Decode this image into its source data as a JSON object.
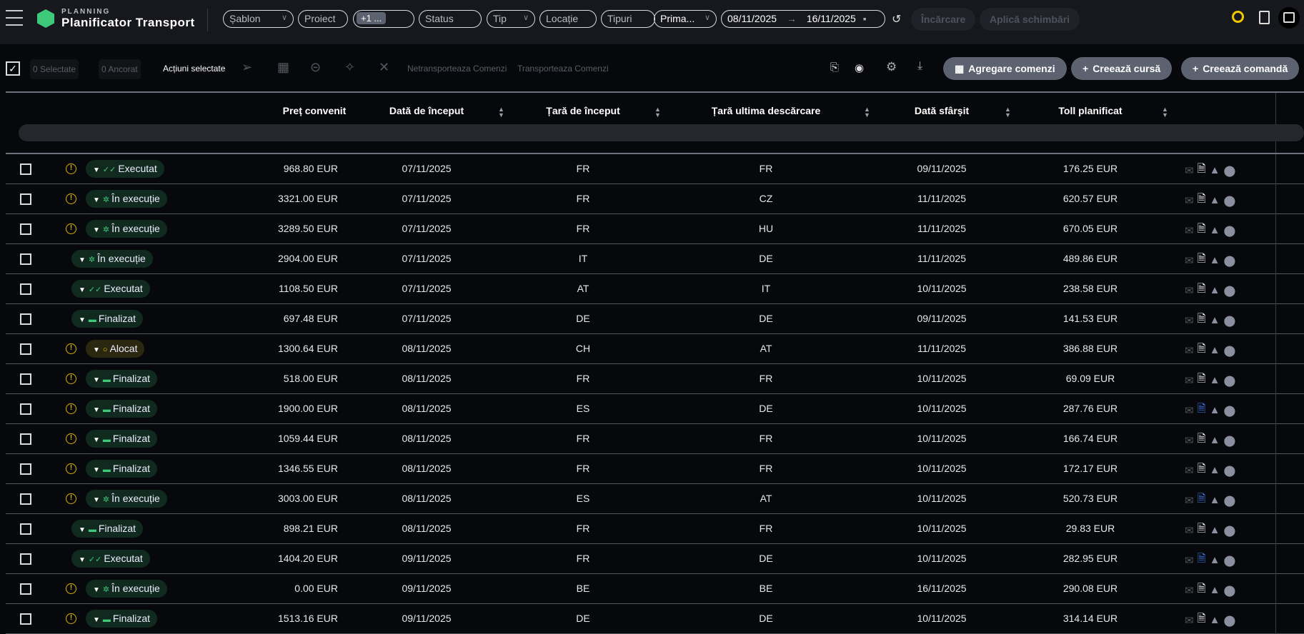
{
  "header": {
    "brand_small": "PLANNING",
    "brand": "Planificator Transport",
    "filters": {
      "sablon": "Șablon",
      "proiect": "Proiect",
      "chip": "+1 ...",
      "status": "Status",
      "tip": "Tip",
      "locatie": "Locație",
      "tipuri": "Tipuri",
      "prima": "Prima...",
      "date_from": "08/11/2025",
      "date_to": "16/11/2025"
    },
    "incarcare": "Încărcare",
    "aplica": "Aplică schimbări"
  },
  "toolbar": {
    "selectate": "0 Selectate",
    "ancorat": "0 Ancorat",
    "actiuni": "Acțiuni selectate",
    "netransporteaza": "Netransporteaza Comenzi",
    "transporteaza": "Transporteaza Comenzi",
    "agregare": "Agregare comenzi",
    "creeaza_cursa": "Creează cursă",
    "creeaza_comanda": "Creează comandă"
  },
  "columns": {
    "pret": "Preț convenit",
    "data_inceput": "Dată de început",
    "tara_inceput": "Țară de început",
    "tara_ultima": "Țară ultima descărcare",
    "data_sfarsit": "Dată sfârșit",
    "toll": "Toll planificat"
  },
  "rows": [
    {
      "warn": true,
      "status": "Executat",
      "type": "exec",
      "price": "968.80 EUR",
      "start": "07/11/2025",
      "from": "FR",
      "to": "FR",
      "end": "09/11/2025",
      "toll": "176.25 EUR",
      "doc_blue": false
    },
    {
      "warn": true,
      "status": "În execuție",
      "type": "prog",
      "price": "3321.00 EUR",
      "start": "07/11/2025",
      "from": "FR",
      "to": "CZ",
      "end": "11/11/2025",
      "toll": "620.57 EUR",
      "doc_blue": false
    },
    {
      "warn": true,
      "status": "În execuție",
      "type": "prog",
      "price": "3289.50 EUR",
      "start": "07/11/2025",
      "from": "FR",
      "to": "HU",
      "end": "11/11/2025",
      "toll": "670.05 EUR",
      "doc_blue": false
    },
    {
      "warn": false,
      "status": "În execuție",
      "type": "prog",
      "price": "2904.00 EUR",
      "start": "07/11/2025",
      "from": "IT",
      "to": "DE",
      "end": "11/11/2025",
      "toll": "489.86 EUR",
      "doc_blue": false
    },
    {
      "warn": false,
      "status": "Executat",
      "type": "exec",
      "price": "1108.50 EUR",
      "start": "07/11/2025",
      "from": "AT",
      "to": "IT",
      "end": "10/11/2025",
      "toll": "238.58 EUR",
      "doc_blue": false
    },
    {
      "warn": false,
      "status": "Finalizat",
      "type": "fin",
      "price": "697.48 EUR",
      "start": "07/11/2025",
      "from": "DE",
      "to": "DE",
      "end": "09/11/2025",
      "toll": "141.53 EUR",
      "doc_blue": false
    },
    {
      "warn": true,
      "status": "Alocat",
      "type": "aloc",
      "price": "1300.64 EUR",
      "start": "08/11/2025",
      "from": "CH",
      "to": "AT",
      "end": "11/11/2025",
      "toll": "386.88 EUR",
      "doc_blue": false
    },
    {
      "warn": true,
      "status": "Finalizat",
      "type": "fin",
      "price": "518.00 EUR",
      "start": "08/11/2025",
      "from": "FR",
      "to": "FR",
      "end": "10/11/2025",
      "toll": "69.09 EUR",
      "doc_blue": false
    },
    {
      "warn": true,
      "status": "Finalizat",
      "type": "fin",
      "price": "1900.00 EUR",
      "start": "08/11/2025",
      "from": "ES",
      "to": "DE",
      "end": "10/11/2025",
      "toll": "287.76 EUR",
      "doc_blue": true
    },
    {
      "warn": true,
      "status": "Finalizat",
      "type": "fin",
      "price": "1059.44 EUR",
      "start": "08/11/2025",
      "from": "FR",
      "to": "FR",
      "end": "10/11/2025",
      "toll": "166.74 EUR",
      "doc_blue": false
    },
    {
      "warn": true,
      "status": "Finalizat",
      "type": "fin",
      "price": "1346.55 EUR",
      "start": "08/11/2025",
      "from": "FR",
      "to": "FR",
      "end": "10/11/2025",
      "toll": "172.17 EUR",
      "doc_blue": false
    },
    {
      "warn": true,
      "status": "În execuție",
      "type": "prog",
      "price": "3003.00 EUR",
      "start": "08/11/2025",
      "from": "ES",
      "to": "AT",
      "end": "10/11/2025",
      "toll": "520.73 EUR",
      "doc_blue": true
    },
    {
      "warn": false,
      "status": "Finalizat",
      "type": "fin",
      "price": "898.21 EUR",
      "start": "08/11/2025",
      "from": "FR",
      "to": "FR",
      "end": "10/11/2025",
      "toll": "29.83 EUR",
      "doc_blue": false
    },
    {
      "warn": false,
      "status": "Executat",
      "type": "exec",
      "price": "1404.20 EUR",
      "start": "09/11/2025",
      "from": "FR",
      "to": "DE",
      "end": "10/11/2025",
      "toll": "282.95 EUR",
      "doc_blue": true
    },
    {
      "warn": true,
      "status": "În execuție",
      "type": "prog",
      "price": "0.00 EUR",
      "start": "09/11/2025",
      "from": "BE",
      "to": "BE",
      "end": "16/11/2025",
      "toll": "290.08 EUR",
      "doc_blue": false
    },
    {
      "warn": true,
      "status": "Finalizat",
      "type": "fin",
      "price": "1513.16 EUR",
      "start": "09/11/2025",
      "from": "DE",
      "to": "DE",
      "end": "10/11/2025",
      "toll": "314.14 EUR",
      "doc_blue": false
    }
  ]
}
